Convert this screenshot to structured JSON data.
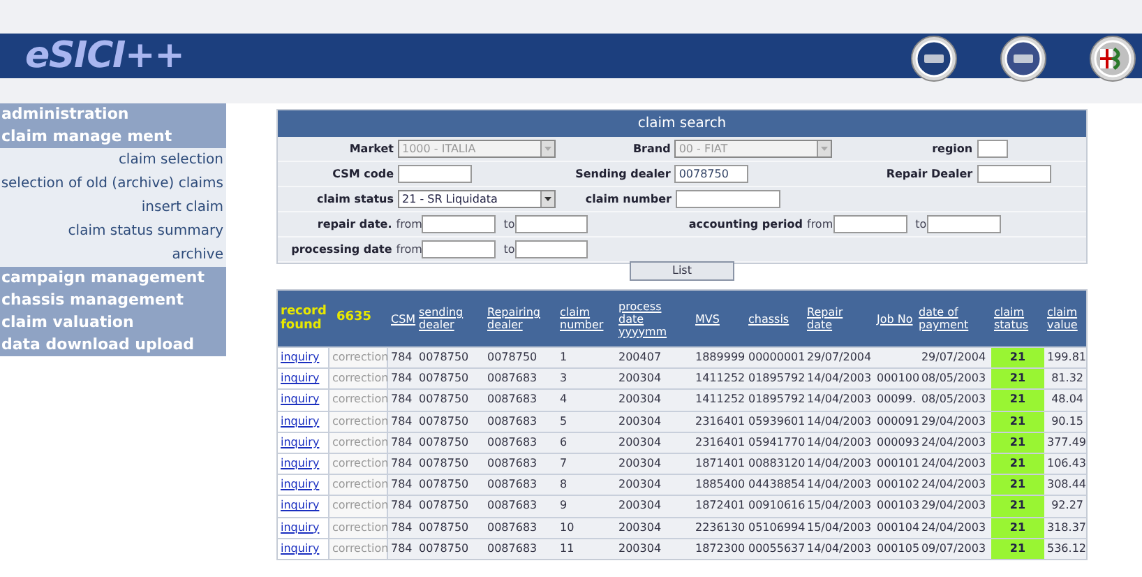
{
  "header": {
    "logo": "eSICI++"
  },
  "sidebar": [
    {
      "label": "administration",
      "kind": "group"
    },
    {
      "label": "claim manage ment",
      "kind": "group"
    },
    {
      "label": "claim selection",
      "kind": "item"
    },
    {
      "label": "selection of old (archive) claims",
      "kind": "item"
    },
    {
      "label": "insert claim",
      "kind": "item"
    },
    {
      "label": "claim status summary",
      "kind": "item"
    },
    {
      "label": "archive",
      "kind": "item"
    },
    {
      "label": "campaign management",
      "kind": "group"
    },
    {
      "label": "chassis management",
      "kind": "group"
    },
    {
      "label": "claim valuation",
      "kind": "group"
    },
    {
      "label": "data download upload",
      "kind": "group"
    }
  ],
  "search": {
    "title": "claim search",
    "rows": [
      [
        {
          "label": "Market",
          "kind": "select",
          "value": "1000 - ITALIA",
          "disabled": true
        },
        {
          "label": "Brand",
          "kind": "select",
          "value": "00 - FIAT",
          "disabled": true
        },
        {
          "label": "region",
          "kind": "input"
        }
      ],
      [
        {
          "label": "CSM code",
          "kind": "input"
        },
        {
          "label": "Sending dealer",
          "kind": "input",
          "value": "0078750"
        },
        {
          "label": "Repair Dealer",
          "kind": "input"
        }
      ],
      [
        {
          "label": "claim status",
          "kind": "select",
          "value": "21 - SR Liquidata",
          "disabled": false
        },
        {
          "label": "claim number",
          "kind": "input"
        }
      ],
      [
        {
          "label": "repair date.",
          "kind": "range",
          "from": "from",
          "to": "to"
        },
        {
          "label": "accounting period",
          "kind": "range",
          "from": "from",
          "to": "to"
        }
      ],
      [
        {
          "label": "processing date",
          "kind": "range",
          "from": "from",
          "to": "to"
        }
      ]
    ],
    "button": "List"
  },
  "table": {
    "record_label": "record found",
    "record_count": "6635",
    "columns": [
      "CSM",
      "sending dealer",
      "Repairing dealer",
      "claim number",
      "process date yyyymm",
      "MVS",
      "chassis",
      "Repair date",
      "Job No",
      "date of payment",
      "claim status",
      "claim value"
    ],
    "rows": [
      {
        "action": "inquiry",
        "correction": "correction",
        "cells": [
          "784",
          "0078750",
          "0078750",
          "1",
          "200407",
          "1889999",
          "00000001",
          "29/07/2004",
          "",
          "29/07/2004",
          "21",
          "199.81"
        ]
      },
      {
        "action": "inquiry",
        "correction": "correction",
        "cells": [
          "784",
          "0078750",
          "0087683",
          "3",
          "200304",
          "1411252",
          "01895792",
          "14/04/2003",
          "000100",
          "08/05/2003",
          "21",
          "81.32"
        ]
      },
      {
        "action": "inquiry",
        "correction": "correction",
        "cells": [
          "784",
          "0078750",
          "0087683",
          "4",
          "200304",
          "1411252",
          "01895792",
          "14/04/2003",
          "00099.",
          "08/05/2003",
          "21",
          "48.04"
        ]
      },
      {
        "action": "inquiry",
        "correction": "correction",
        "cells": [
          "784",
          "0078750",
          "0087683",
          "5",
          "200304",
          "2316401",
          "05939601",
          "14/04/2003",
          "000091",
          "29/04/2003",
          "21",
          "90.15"
        ]
      },
      {
        "action": "inquiry",
        "correction": "correction",
        "cells": [
          "784",
          "0078750",
          "0087683",
          "6",
          "200304",
          "2316401",
          "05941770",
          "14/04/2003",
          "000093",
          "24/04/2003",
          "21",
          "377.49"
        ]
      },
      {
        "action": "inquiry",
        "correction": "correction",
        "cells": [
          "784",
          "0078750",
          "0087683",
          "7",
          "200304",
          "1871401",
          "00883120",
          "14/04/2003",
          "000101",
          "24/04/2003",
          "21",
          "106.43"
        ]
      },
      {
        "action": "inquiry",
        "correction": "correction",
        "cells": [
          "784",
          "0078750",
          "0087683",
          "8",
          "200304",
          "1885400",
          "04438854",
          "14/04/2003",
          "000102",
          "24/04/2003",
          "21",
          "308.44"
        ]
      },
      {
        "action": "inquiry",
        "correction": "correction",
        "cells": [
          "784",
          "0078750",
          "0087683",
          "9",
          "200304",
          "1872401",
          "00910616",
          "15/04/2003",
          "000103",
          "29/04/2003",
          "21",
          "92.27"
        ]
      },
      {
        "action": "inquiry",
        "correction": "correction",
        "cells": [
          "784",
          "0078750",
          "0087683",
          "10",
          "200304",
          "2236130",
          "05106994",
          "15/04/2003",
          "000104",
          "24/04/2003",
          "21",
          "318.37"
        ]
      },
      {
        "action": "inquiry",
        "correction": "correction",
        "cells": [
          "784",
          "0078750",
          "0087683",
          "11",
          "200304",
          "1872300",
          "00055637",
          "14/04/2003",
          "000105",
          "09/07/2003",
          "21",
          "536.12"
        ]
      }
    ]
  }
}
